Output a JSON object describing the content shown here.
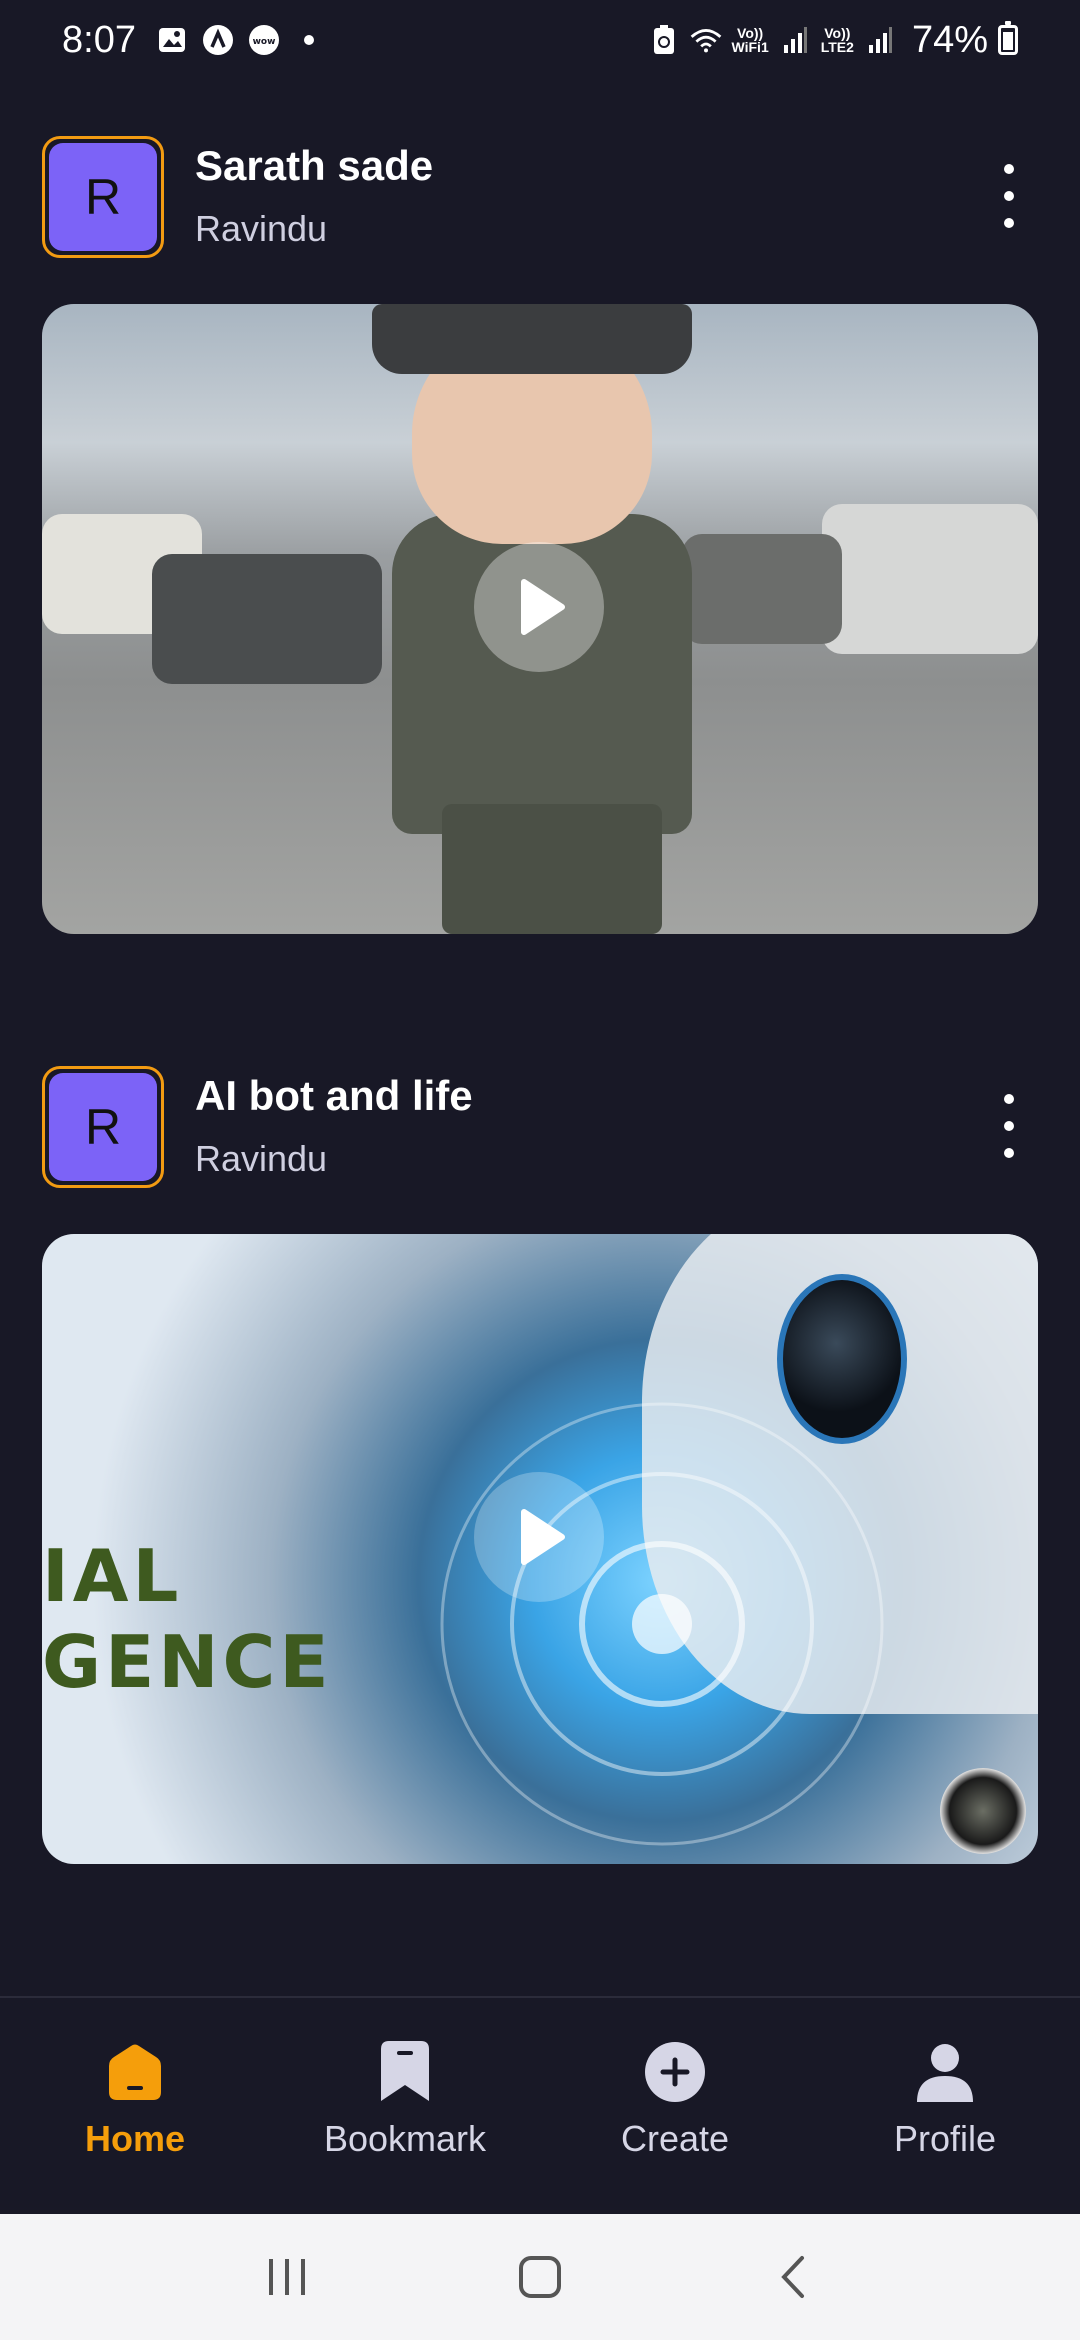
{
  "status_bar": {
    "time": "8:07",
    "left_icons": [
      "image-icon",
      "app-a-icon",
      "wow-icon"
    ],
    "signal_labels": [
      {
        "top": "Vo))",
        "bottom": "WiFi1"
      },
      {
        "top": "Vo))",
        "bottom": "LTE2"
      }
    ],
    "battery": "74%",
    "battery_level": 0.74
  },
  "posts": [
    {
      "avatar_letter": "R",
      "title": "Sarath sade",
      "author": "Ravindu",
      "media": "video-thumbnail-soldier"
    },
    {
      "avatar_letter": "R",
      "title": "AI bot and life",
      "author": "Ravindu",
      "media": "video-thumbnail-ai",
      "overlay_text_line1": "IAL",
      "overlay_text_line2": "GENCE"
    }
  ],
  "bottom_nav": {
    "items": [
      {
        "label": "Home",
        "icon": "home-icon",
        "active": true
      },
      {
        "label": "Bookmark",
        "icon": "bookmark-icon",
        "active": false
      },
      {
        "label": "Create",
        "icon": "plus-circle-icon",
        "active": false
      },
      {
        "label": "Profile",
        "icon": "person-icon",
        "active": false
      }
    ]
  },
  "colors": {
    "background": "#181826",
    "accent": "#f59e0b",
    "avatar": "#7c63f7"
  }
}
